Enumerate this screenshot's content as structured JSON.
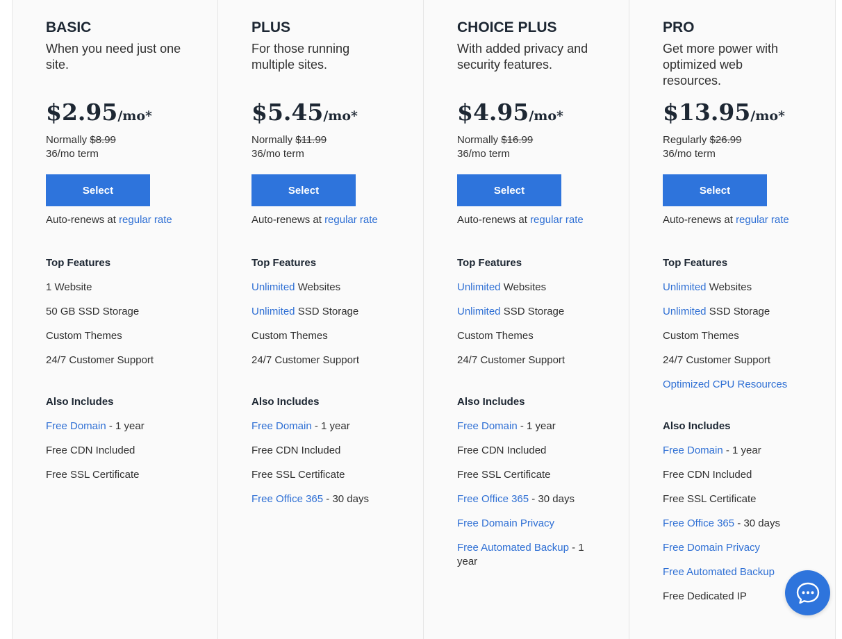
{
  "plans": [
    {
      "name": "BASIC",
      "tagline": "When you need just one site.",
      "price": "$2.95",
      "suffix": "/mo*",
      "normal_label": "Normally",
      "normal_price": "$8.99",
      "term": "36/mo term",
      "select_label": "Select",
      "autorenew_prefix": "Auto-renews at",
      "autorenew_link": "regular rate",
      "top_features_label": "Top Features",
      "features": [
        {
          "link": "",
          "text": "1 Website"
        },
        {
          "link": "",
          "text": "50 GB SSD Storage"
        },
        {
          "link": "",
          "text": "Custom Themes"
        },
        {
          "link": "",
          "text": "24/7 Customer Support"
        }
      ],
      "also_label": "Also Includes",
      "also": [
        {
          "link": "Free Domain",
          "text": " - 1 year"
        },
        {
          "link": "",
          "text": "Free CDN Included"
        },
        {
          "link": "",
          "text": "Free SSL Certificate"
        }
      ]
    },
    {
      "name": "PLUS",
      "tagline": "For those running multiple sites.",
      "price": "$5.45",
      "suffix": "/mo*",
      "normal_label": "Normally",
      "normal_price": "$11.99",
      "term": "36/mo term",
      "select_label": "Select",
      "autorenew_prefix": "Auto-renews at",
      "autorenew_link": "regular rate",
      "top_features_label": "Top Features",
      "features": [
        {
          "link": "Unlimited",
          "text": " Websites"
        },
        {
          "link": "Unlimited",
          "text": " SSD Storage"
        },
        {
          "link": "",
          "text": "Custom Themes"
        },
        {
          "link": "",
          "text": "24/7 Customer Support"
        }
      ],
      "also_label": "Also Includes",
      "also": [
        {
          "link": "Free Domain",
          "text": " - 1 year"
        },
        {
          "link": "",
          "text": "Free CDN Included"
        },
        {
          "link": "",
          "text": "Free SSL Certificate"
        },
        {
          "link": "Free Office 365",
          "text": " - 30 days"
        }
      ]
    },
    {
      "name": "CHOICE PLUS",
      "tagline": "With added privacy and security features.",
      "price": "$4.95",
      "suffix": "/mo*",
      "normal_label": "Normally",
      "normal_price": "$16.99",
      "term": "36/mo term",
      "select_label": "Select",
      "autorenew_prefix": "Auto-renews at",
      "autorenew_link": "regular rate",
      "top_features_label": "Top Features",
      "features": [
        {
          "link": "Unlimited",
          "text": " Websites"
        },
        {
          "link": "Unlimited",
          "text": " SSD Storage"
        },
        {
          "link": "",
          "text": "Custom Themes"
        },
        {
          "link": "",
          "text": "24/7 Customer Support"
        }
      ],
      "also_label": "Also Includes",
      "also": [
        {
          "link": "Free Domain",
          "text": " - 1 year"
        },
        {
          "link": "",
          "text": "Free CDN Included"
        },
        {
          "link": "",
          "text": "Free SSL Certificate"
        },
        {
          "link": "Free Office 365",
          "text": " - 30 days"
        },
        {
          "link": "Free Domain Privacy",
          "text": ""
        },
        {
          "link": "Free Automated Backup",
          "text": " - 1 year"
        }
      ]
    },
    {
      "name": "PRO",
      "tagline": "Get more power with optimized web resources.",
      "price": "$13.95",
      "suffix": "/mo*",
      "normal_label": "Regularly",
      "normal_price": "$26.99",
      "term": "36/mo term",
      "select_label": "Select",
      "autorenew_prefix": "Auto-renews at",
      "autorenew_link": "regular rate",
      "top_features_label": "Top Features",
      "features": [
        {
          "link": "Unlimited",
          "text": " Websites"
        },
        {
          "link": "Unlimited",
          "text": " SSD Storage"
        },
        {
          "link": "",
          "text": "Custom Themes"
        },
        {
          "link": "",
          "text": "24/7 Customer Support"
        },
        {
          "link": "Optimized CPU Resources",
          "text": ""
        }
      ],
      "also_label": "Also Includes",
      "also": [
        {
          "link": "Free Domain",
          "text": " - 1 year"
        },
        {
          "link": "",
          "text": "Free CDN Included"
        },
        {
          "link": "",
          "text": "Free SSL Certificate"
        },
        {
          "link": "Free Office 365",
          "text": " - 30 days"
        },
        {
          "link": "Free Domain Privacy",
          "text": ""
        },
        {
          "link": "Free Automated Backup",
          "text": ""
        },
        {
          "link": "",
          "text": "Free Dedicated IP"
        }
      ]
    }
  ],
  "chat": {
    "icon": "chat-bubble-icon",
    "color": "#2e74dc"
  },
  "colors": {
    "accent": "#2e74dc",
    "link": "#2e6fd4",
    "heading": "#1d2733"
  }
}
